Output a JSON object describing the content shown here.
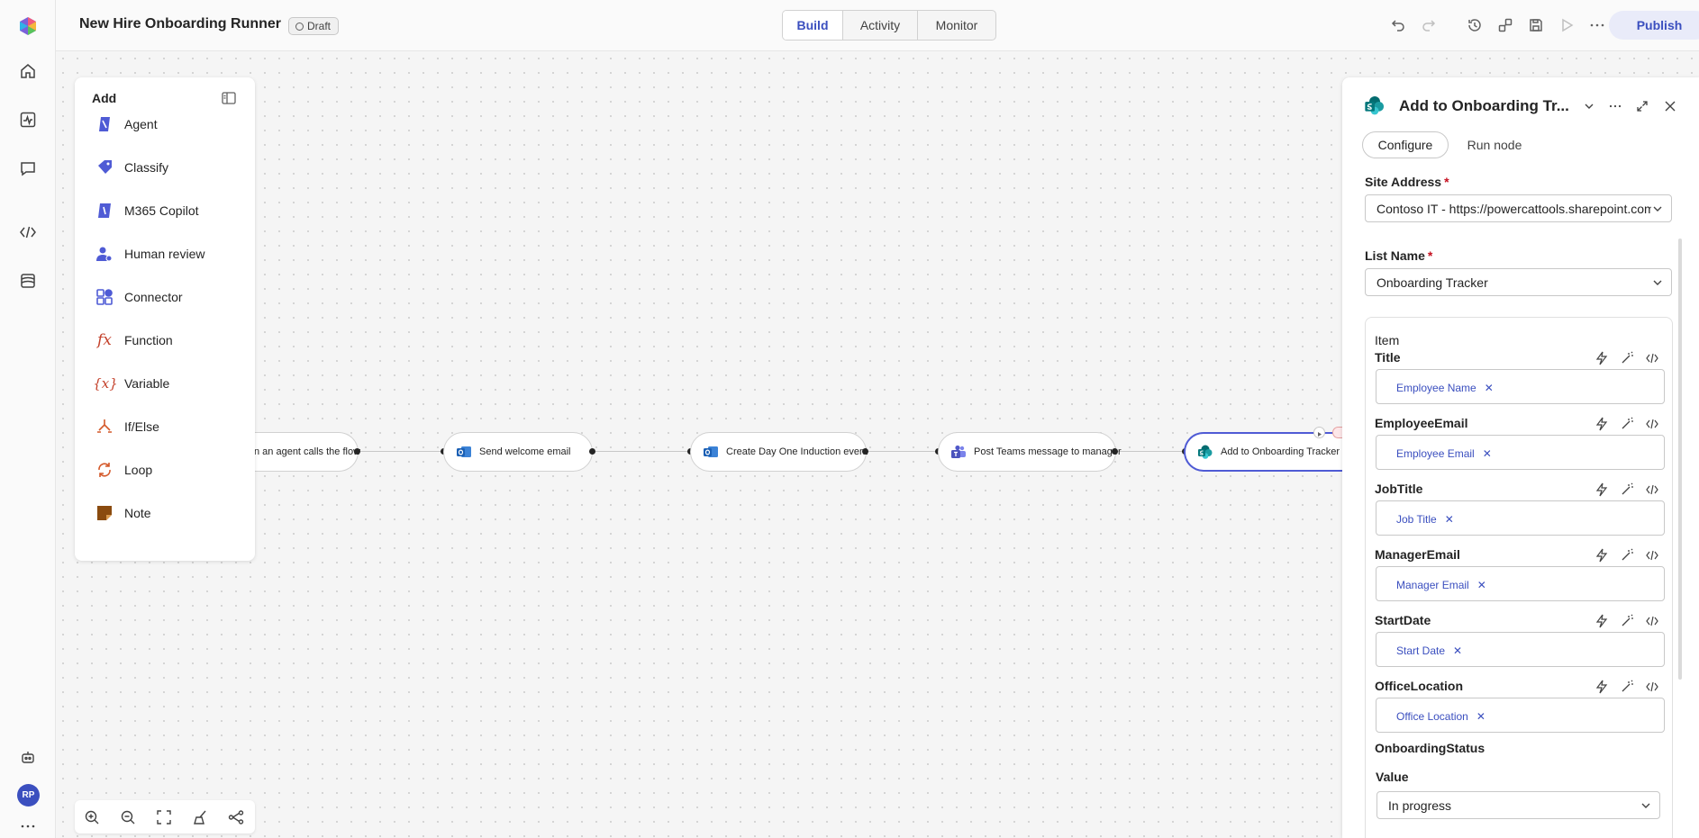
{
  "app": {
    "title": "New Hire Onboarding Runner",
    "status": "Draft"
  },
  "header_tabs": [
    {
      "label": "Build",
      "active": true
    },
    {
      "label": "Activity",
      "active": false
    },
    {
      "label": "Monitor",
      "active": false
    }
  ],
  "header_actions": [
    "undo-icon",
    "redo-icon",
    "history-icon",
    "share-icon",
    "save-icon",
    "run-icon",
    "more-icon"
  ],
  "publish_label": "Publish",
  "rail": {
    "items": [
      "home-icon",
      "activity-icon",
      "chat-icon",
      "code-icon",
      "dataset-icon"
    ],
    "bottom": [
      "agent-icon"
    ],
    "avatar": "RP",
    "more": "..."
  },
  "add_panel": {
    "title": "Add",
    "items": [
      {
        "label": "Agent",
        "icon": "agent-icon"
      },
      {
        "label": "Classify",
        "icon": "classify-icon"
      },
      {
        "label": "M365 Copilot",
        "icon": "copilot-icon"
      },
      {
        "label": "Human review",
        "icon": "human-review-icon"
      },
      {
        "label": "Connector",
        "icon": "connector-icon"
      },
      {
        "label": "Function",
        "icon": "function-icon"
      },
      {
        "label": "Variable",
        "icon": "variable-icon"
      },
      {
        "label": "If/Else",
        "icon": "branch-icon"
      },
      {
        "label": "Loop",
        "icon": "loop-icon"
      },
      {
        "label": "Note",
        "icon": "note-icon"
      }
    ]
  },
  "flow": {
    "nodes": [
      {
        "label": "n an agent calls the flow",
        "icon": "none"
      },
      {
        "label": "Send welcome email",
        "icon": "outlook-icon"
      },
      {
        "label": "Create Day One Induction event",
        "icon": "outlook-icon"
      },
      {
        "label": "Post Teams message to manager",
        "icon": "teams-icon"
      },
      {
        "label": "Add to Onboarding Tracker",
        "icon": "sharepoint-icon",
        "selected": true
      }
    ]
  },
  "zoom_toolbar": [
    "zoom-in-icon",
    "zoom-out-icon",
    "fit-view-icon",
    "clean-up-icon",
    "layout-icon"
  ],
  "config_panel": {
    "title": "Add to Onboarding Tr...",
    "tabs": [
      {
        "label": "Configure",
        "active": true
      },
      {
        "label": "Run node",
        "active": false
      }
    ],
    "site_address": {
      "label": "Site Address",
      "value": "Contoso IT - https://powercattools.sharepoint.com"
    },
    "list_name": {
      "label": "List Name",
      "value": "Onboarding Tracker"
    },
    "item": {
      "label": "Item",
      "fields": [
        {
          "label": "Title",
          "token": "Employee Name"
        },
        {
          "label": "EmployeeEmail",
          "token": "Employee Email"
        },
        {
          "label": "JobTitle",
          "token": "Job Title"
        },
        {
          "label": "ManagerEmail",
          "token": "Manager Email"
        },
        {
          "label": "StartDate",
          "token": "Start Date"
        },
        {
          "label": "OfficeLocation",
          "token": "Office Location"
        }
      ],
      "status_group": {
        "label": "OnboardingStatus",
        "value_label": "Value",
        "value": "In progress"
      }
    }
  },
  "colors": {
    "accent": "#3b4fbf",
    "selected_border": "#4f5bd5",
    "required": "#c50f1f"
  }
}
